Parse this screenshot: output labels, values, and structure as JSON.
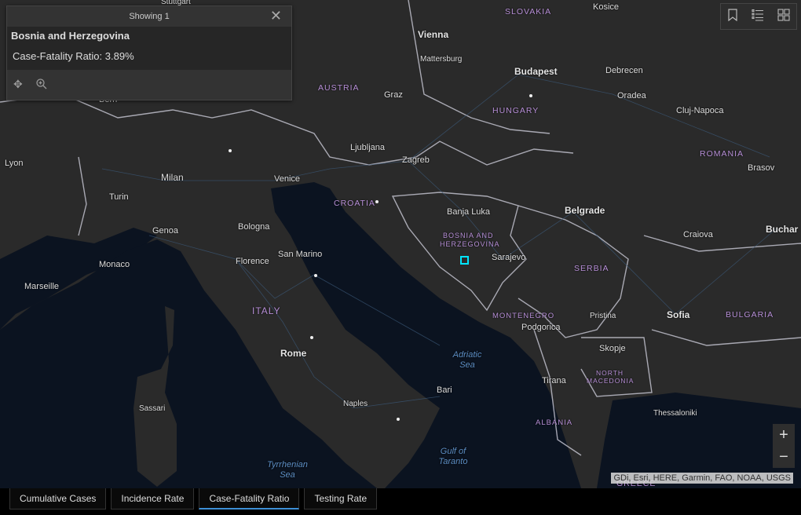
{
  "popup": {
    "header": "Showing 1",
    "title": "Bosnia and Herzegovina",
    "field_label": "Case-Fatality Ratio",
    "field_value": "3.89%",
    "value_text": "Case-Fatality Ratio: 3.89%",
    "actions": [
      "pan-icon",
      "zoom-to-icon"
    ]
  },
  "tools": [
    "bookmark-icon",
    "legend-list-icon",
    "basemap-gallery-icon"
  ],
  "zoom": {
    "in": "+",
    "out": "−"
  },
  "attribution": "GDi, Esri, HERE, Garmin, FAO, NOAA, USGS",
  "tabs": [
    {
      "label": "Cumulative Cases",
      "active": false
    },
    {
      "label": "Incidence Rate",
      "active": false
    },
    {
      "label": "Case-Fatality Ratio",
      "active": true
    },
    {
      "label": "Testing Rate",
      "active": false
    }
  ],
  "map": {
    "countries": [
      "SLOVAKIA",
      "AUSTRIA",
      "HUNGARY",
      "ROMANIA",
      "CROATIA",
      "BOSNIA AND",
      "HERZEGOVINA",
      "SERBIA",
      "MONTENEGRO",
      "ITALY",
      "BULGARIA",
      "NORTH",
      "MACEDONIA",
      "ALBANIA",
      "GREECE"
    ],
    "cities": [
      "Vienna",
      "Budapest",
      "Kosice",
      "Mattersburg",
      "Debrecen",
      "Graz",
      "Oradea",
      "Cluj-Napoca",
      "Ljubljana",
      "Zagreb",
      "Brasov",
      "Lyon",
      "Milan",
      "Venice",
      "Turin",
      "Banja Luka",
      "Belgrade",
      "Genoa",
      "Bologna",
      "Craiova",
      "Buchar",
      "Monaco",
      "Florence",
      "San Marino",
      "Sarajevo",
      "Marseille",
      "Podgorica",
      "Pristina",
      "Sofia",
      "Rome",
      "Skopje",
      "Tirana",
      "Bari",
      "Naples",
      "Thessaloniki",
      "Sassari",
      "Bern",
      "Stuttgart"
    ],
    "seas": [
      "Adriatic Sea",
      "Gulf of Taranto",
      "Tyrrhenian Sea"
    ],
    "selected_feature": "Bosnia and Herzegovina"
  }
}
